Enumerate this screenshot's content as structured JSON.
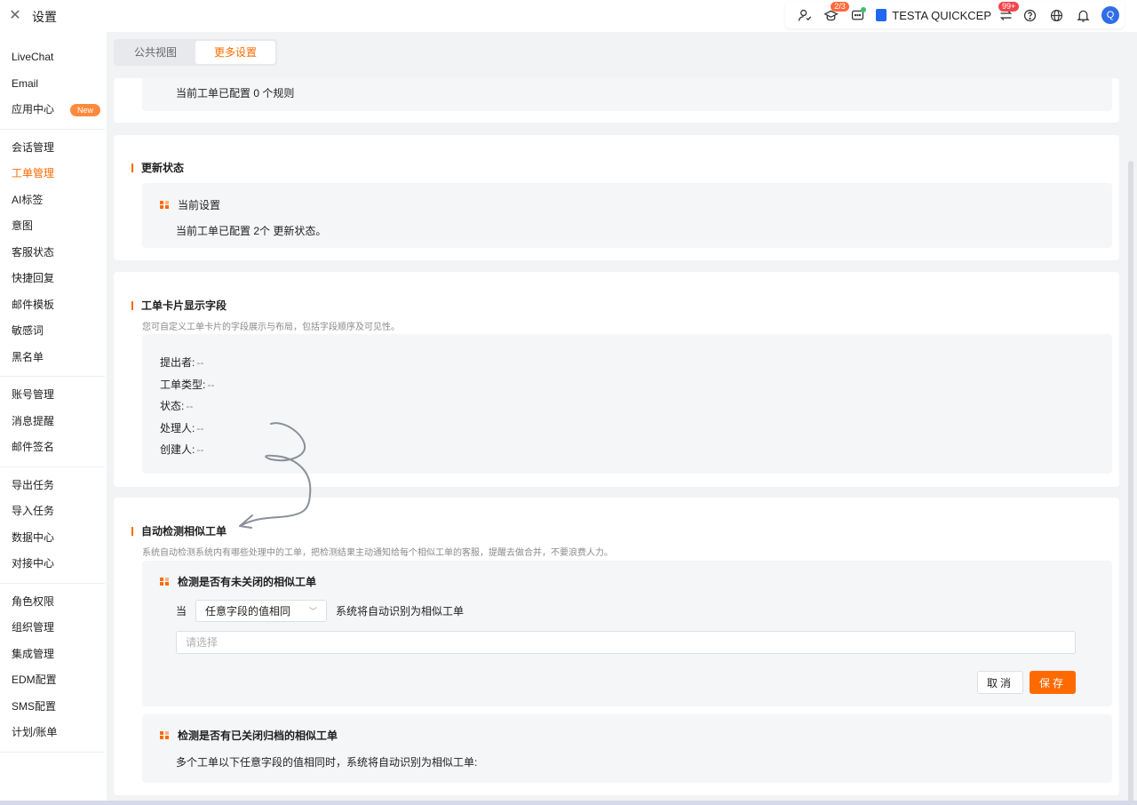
{
  "app": {
    "title": "设置"
  },
  "topbar": {
    "badges": {
      "learn": "2/3",
      "switch": "99+"
    },
    "company": "TESTA QUICKCEP",
    "avatar": "Q"
  },
  "sidebar": {
    "groups": [
      [
        {
          "label": "LiveChat"
        },
        {
          "label": "Email"
        },
        {
          "label": "应用中心",
          "badge": "New"
        }
      ],
      [
        {
          "label": "会话管理"
        },
        {
          "label": "工单管理",
          "active": true
        },
        {
          "label": "AI标签"
        },
        {
          "label": "意图"
        },
        {
          "label": "客服状态"
        },
        {
          "label": "快捷回复"
        },
        {
          "label": "邮件模板"
        },
        {
          "label": "敏感词"
        },
        {
          "label": "黑名单"
        }
      ],
      [
        {
          "label": "账号管理"
        },
        {
          "label": "消息提醒"
        },
        {
          "label": "邮件签名"
        }
      ],
      [
        {
          "label": "导出任务"
        },
        {
          "label": "导入任务"
        },
        {
          "label": "数据中心"
        },
        {
          "label": "对接中心"
        }
      ],
      [
        {
          "label": "角色权限"
        },
        {
          "label": "组织管理"
        },
        {
          "label": "集成管理"
        },
        {
          "label": "EDM配置"
        },
        {
          "label": "SMS配置"
        },
        {
          "label": "计划/账单"
        }
      ]
    ]
  },
  "tabs": {
    "public_view": "公共视图",
    "more_settings": "更多设置"
  },
  "panel_top": {
    "text": "当前工单已配置 0 个规则"
  },
  "update_status": {
    "title": "更新状态",
    "box_title": "当前设置",
    "text": "当前工单已配置 2个 更新状态。"
  },
  "card_fields": {
    "title": "工单卡片显示字段",
    "desc": "您可自定义工单卡片的字段展示与布局，包括字段顺序及可见性。",
    "fields": [
      {
        "label": "提出者:",
        "value": "--"
      },
      {
        "label": "工单类型:",
        "value": "--"
      },
      {
        "label": "状态:",
        "value": "--"
      },
      {
        "label": "处理人:",
        "value": "--"
      },
      {
        "label": "创建人:",
        "value": "--"
      }
    ]
  },
  "similar": {
    "title": "自动检测相似工单",
    "desc": "系统自动检测系统内有哪些处理中的工单，把检测结果主动通知给每个相似工单的客服，提醒去做合并，不要浪费人力。",
    "open_box": {
      "title": "检测是否有未关闭的相似工单",
      "when": "当",
      "select_value": "任意字段的值相同",
      "suffix": "系统将自动识别为相似工单",
      "input_placeholder": "请选择",
      "cancel": "取消",
      "save": "保存"
    },
    "closed_box": {
      "title": "检测是否有已关闭归档的相似工单",
      "text": "多个工单以下任意字段的值相同时，系统将自动识别为相似工单:"
    }
  },
  "colors": {
    "accent": "#ff6a00",
    "main_bg": "#f2f3f5",
    "box_bg": "#f5f6f7"
  }
}
